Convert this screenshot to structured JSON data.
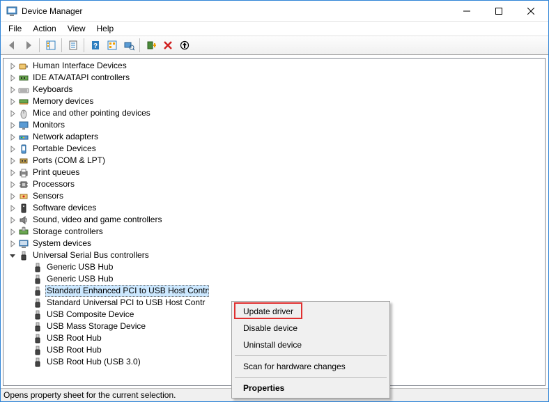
{
  "window": {
    "title": "Device Manager"
  },
  "menu": {
    "items": [
      "File",
      "Action",
      "View",
      "Help"
    ]
  },
  "toolbar": {
    "buttons": [
      {
        "name": "back-icon"
      },
      {
        "name": "forward-icon"
      },
      {
        "name": "show-hide-console-tree-icon"
      },
      {
        "name": "properties-icon"
      },
      {
        "name": "help-icon"
      },
      {
        "name": "show-hidden-devices-icon"
      },
      {
        "name": "scan-hardware-icon"
      },
      {
        "name": "add-legacy-hardware-icon"
      },
      {
        "name": "uninstall-icon"
      },
      {
        "name": "update-driver-icon"
      }
    ]
  },
  "tree": {
    "categories": [
      {
        "label": "Human Interface Devices",
        "expanded": false,
        "icon": "hid-icon"
      },
      {
        "label": "IDE ATA/ATAPI controllers",
        "expanded": false,
        "icon": "ide-icon"
      },
      {
        "label": "Keyboards",
        "expanded": false,
        "icon": "keyboard-icon"
      },
      {
        "label": "Memory devices",
        "expanded": false,
        "icon": "memory-icon"
      },
      {
        "label": "Mice and other pointing devices",
        "expanded": false,
        "icon": "mouse-icon"
      },
      {
        "label": "Monitors",
        "expanded": false,
        "icon": "monitor-icon"
      },
      {
        "label": "Network adapters",
        "expanded": false,
        "icon": "network-icon"
      },
      {
        "label": "Portable Devices",
        "expanded": false,
        "icon": "portable-icon"
      },
      {
        "label": "Ports (COM & LPT)",
        "expanded": false,
        "icon": "port-icon"
      },
      {
        "label": "Print queues",
        "expanded": false,
        "icon": "printer-icon"
      },
      {
        "label": "Processors",
        "expanded": false,
        "icon": "cpu-icon"
      },
      {
        "label": "Sensors",
        "expanded": false,
        "icon": "sensor-icon"
      },
      {
        "label": "Software devices",
        "expanded": false,
        "icon": "software-icon"
      },
      {
        "label": "Sound, video and game controllers",
        "expanded": false,
        "icon": "sound-icon"
      },
      {
        "label": "Storage controllers",
        "expanded": false,
        "icon": "storage-icon"
      },
      {
        "label": "System devices",
        "expanded": false,
        "icon": "system-icon"
      },
      {
        "label": "Universal Serial Bus controllers",
        "expanded": true,
        "icon": "usb-icon",
        "children": [
          {
            "label": "Generic USB Hub",
            "icon": "usb-device-icon"
          },
          {
            "label": "Generic USB Hub",
            "icon": "usb-device-icon"
          },
          {
            "label": "Standard Enhanced PCI to USB Host Contr",
            "icon": "usb-device-icon",
            "selected": true
          },
          {
            "label": "Standard Universal PCI to USB Host Contr",
            "icon": "usb-device-icon"
          },
          {
            "label": "USB Composite Device",
            "icon": "usb-device-icon"
          },
          {
            "label": "USB Mass Storage Device",
            "icon": "usb-device-icon"
          },
          {
            "label": "USB Root Hub",
            "icon": "usb-device-icon"
          },
          {
            "label": "USB Root Hub",
            "icon": "usb-device-icon"
          },
          {
            "label": "USB Root Hub (USB 3.0)",
            "icon": "usb-device-icon"
          }
        ]
      }
    ]
  },
  "context_menu": {
    "items": [
      {
        "label": "Update driver",
        "highlighted": true
      },
      {
        "label": "Disable device"
      },
      {
        "label": "Uninstall device"
      },
      {
        "separator": true
      },
      {
        "label": "Scan for hardware changes"
      },
      {
        "separator": true
      },
      {
        "label": "Properties",
        "bold": true
      }
    ]
  },
  "statusbar": {
    "text": "Opens property sheet for the current selection."
  }
}
